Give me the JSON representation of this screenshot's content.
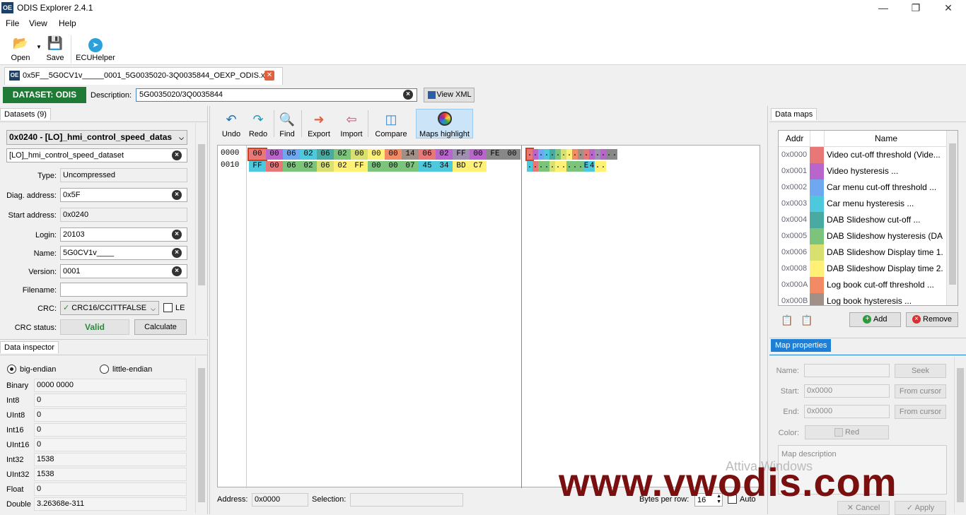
{
  "window": {
    "title": "ODIS Explorer 2.4.1",
    "logo": "OE",
    "minimize": "—",
    "maximize": "❐",
    "close": "✕"
  },
  "menu": [
    "File",
    "View",
    "Help"
  ],
  "toolbar": {
    "open": "Open",
    "save": "Save",
    "ecuhelper": "ECUHelper"
  },
  "file_tab": {
    "label": "0x5F__5G0CV1v_____0001_5G0035020-3Q0035844_OEXP_ODIS.xml",
    "close": "✕"
  },
  "dataset_bar": {
    "badge": "DATASET: ODIS",
    "desc_label": "Description:",
    "desc_value": "5G0035020/3Q0035844",
    "view_xml": "View XML"
  },
  "datasets": {
    "title": "Datasets (9)",
    "selected": "0x0240 - [LO]_hmi_control_speed_datas",
    "name_field": "[LO]_hmi_control_speed_dataset",
    "type_label": "Type:",
    "type_value": "Uncompressed",
    "diag_label": "Diag. address:",
    "diag_value": "0x5F",
    "start_label": "Start address:",
    "start_value": "0x0240",
    "login_label": "Login:",
    "login_value": "20103",
    "name_label": "Name:",
    "name_value": "5G0CV1v____",
    "version_label": "Version:",
    "version_value": "0001",
    "filename_label": "Filename:",
    "filename_value": "",
    "crc_label": "CRC:",
    "crc_value": "CRC16/CCITTFALSE",
    "le_label": "LE",
    "crc_status_label": "CRC status:",
    "crc_status_value": "Valid",
    "calculate": "Calculate"
  },
  "inspector": {
    "title": "Data inspector",
    "big_endian": "big-endian",
    "little_endian": "little-endian",
    "rows": [
      {
        "label": "Binary",
        "value": "0000 0000"
      },
      {
        "label": "Int8",
        "value": "0"
      },
      {
        "label": "UInt8",
        "value": "0"
      },
      {
        "label": "Int16",
        "value": "0"
      },
      {
        "label": "UInt16",
        "value": "0"
      },
      {
        "label": "Int32",
        "value": "1538"
      },
      {
        "label": "UInt32",
        "value": "1538"
      },
      {
        "label": "Float",
        "value": "0"
      },
      {
        "label": "Double",
        "value": "3.26368e-311"
      }
    ]
  },
  "hex_toolbar": {
    "undo": "Undo",
    "redo": "Redo",
    "find": "Find",
    "export": "Export",
    "import": "Import",
    "compare": "Compare",
    "maps_highlight": "Maps highlight"
  },
  "hex": {
    "rows": [
      {
        "offset": "0000",
        "bytes": [
          "00",
          "00",
          "06",
          "02",
          "06",
          "02",
          "00",
          "00",
          "00",
          "14",
          "06",
          "02",
          "FF",
          "00",
          "FE",
          "00"
        ],
        "ascii": "................"
      },
      {
        "offset": "0010",
        "bytes": [
          "FF",
          "00",
          "06",
          "02",
          "06",
          "02",
          "FF",
          "00",
          "00",
          "07",
          "45",
          "34",
          "BD",
          "C7"
        ],
        "ascii": "..........E4.."
      }
    ],
    "colors": [
      [
        "#e87878",
        "#b866cc",
        "#6fa8f0",
        "#4dc8dc",
        "#48aaa0",
        "#7cc47c",
        "#d8e070",
        "#fff176",
        "#f28a64",
        "#a09088",
        "#e87878",
        "#b866cc",
        "#a090b0",
        "#b866cc",
        "#888888",
        "#888888"
      ],
      [
        "#4dc8dc",
        "#e87878",
        "#7cc47c",
        "#7cc47c",
        "#d8e070",
        "#fff176",
        "#fff176",
        "#7cc47c",
        "#7cc47c",
        "#7cc47c",
        "#4dc8dc",
        "#4dc8dc",
        "#fff176",
        "#fff176"
      ]
    ]
  },
  "statusbar": {
    "address_label": "Address:",
    "address_value": "0x0000",
    "selection_label": "Selection:",
    "bpr_label": "Bytes per row:",
    "bpr_value": "16",
    "auto_label": "Auto"
  },
  "data_maps": {
    "title": "Data maps",
    "col_addr": "Addr",
    "col_name": "Name",
    "rows": [
      {
        "addr": "0x0000",
        "color": "#e87878",
        "name": "Video cut-off threshold (Vide..."
      },
      {
        "addr": "0x0001",
        "color": "#b866cc",
        "name": "Video hysteresis ..."
      },
      {
        "addr": "0x0002",
        "color": "#6fa8f0",
        "name": "Car menu cut-off threshold ..."
      },
      {
        "addr": "0x0003",
        "color": "#4dc8dc",
        "name": "Car menu hysteresis ..."
      },
      {
        "addr": "0x0004",
        "color": "#48aaa0",
        "name": "DAB Slideshow cut-off ..."
      },
      {
        "addr": "0x0005",
        "color": "#7cc47c",
        "name": "DAB Slideshow hysteresis (DA..."
      },
      {
        "addr": "0x0006",
        "color": "#d8e070",
        "name": "DAB Slideshow Display time 1..."
      },
      {
        "addr": "0x0008",
        "color": "#fff176",
        "name": "DAB Slideshow Display time 2..."
      },
      {
        "addr": "0x000A",
        "color": "#f28a64",
        "name": "Log book cut-off threshold ..."
      },
      {
        "addr": "0x000B",
        "color": "#a09088",
        "name": "Log book hysteresis ..."
      }
    ],
    "add": "Add",
    "remove": "Remove"
  },
  "map_props": {
    "title": "Map properties",
    "name_label": "Name:",
    "seek": "Seek",
    "start_label": "Start:",
    "start_value": "0x0000",
    "from_cursor": "From cursor",
    "end_label": "End:",
    "end_value": "0x0000",
    "color_label": "Color:",
    "color_value": "Red",
    "desc_label": "Map description",
    "cancel": "Cancel",
    "apply": "Apply"
  },
  "overlay": {
    "watermark": "www.vwodis.com",
    "activation": "Attiva Windows"
  }
}
